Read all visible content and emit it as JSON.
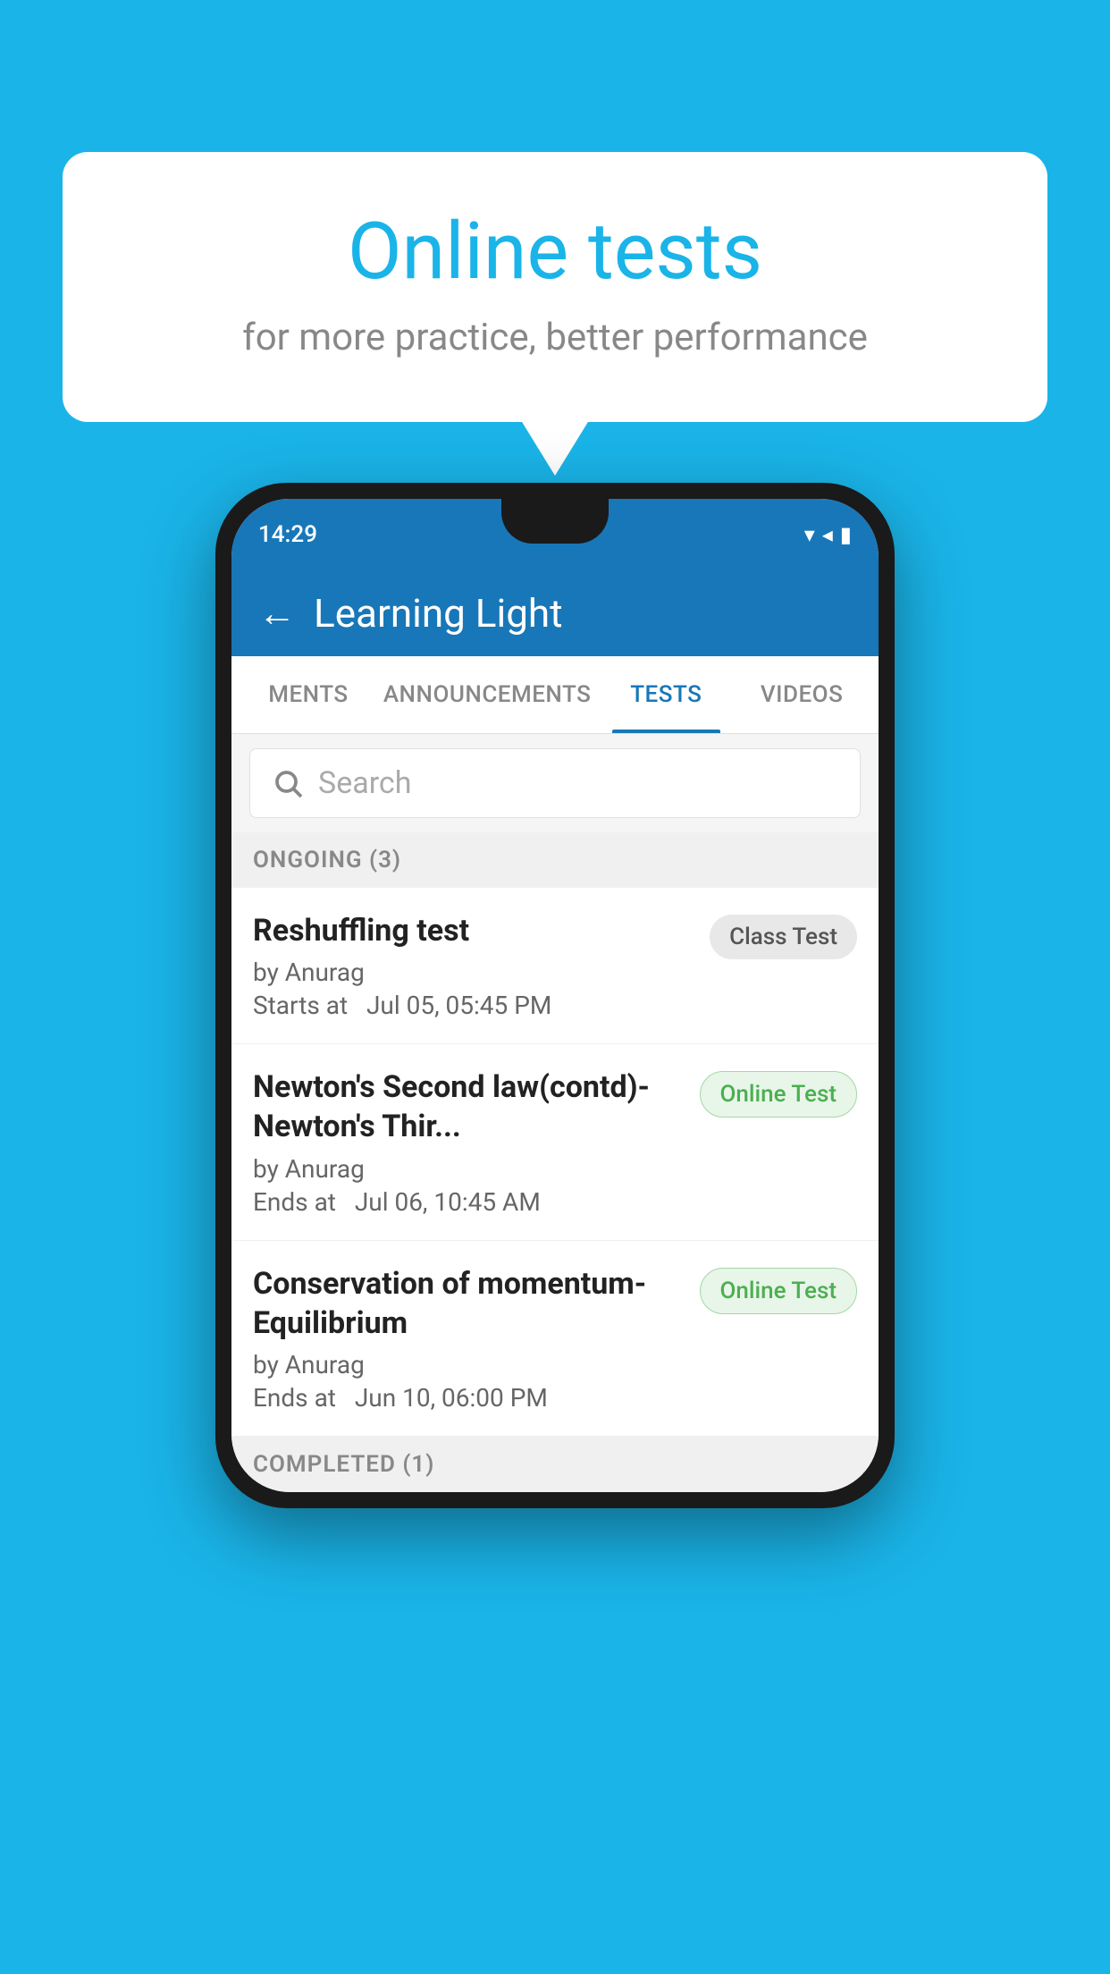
{
  "background": {
    "color": "#1ab4e8"
  },
  "speech_bubble": {
    "title": "Online tests",
    "subtitle": "for more practice, better performance"
  },
  "phone": {
    "status_bar": {
      "time": "14:29",
      "icons": [
        "wifi",
        "signal",
        "battery"
      ]
    },
    "header": {
      "title": "Learning Light",
      "back_label": "←"
    },
    "tabs": [
      {
        "label": "MENTS",
        "active": false
      },
      {
        "label": "ANNOUNCEMENTS",
        "active": false
      },
      {
        "label": "TESTS",
        "active": true
      },
      {
        "label": "VIDEOS",
        "active": false
      }
    ],
    "search": {
      "placeholder": "Search"
    },
    "sections": [
      {
        "label": "ONGOING (3)",
        "tests": [
          {
            "name": "Reshuffling test",
            "author": "by Anurag",
            "time_label": "Starts at",
            "time": "Jul 05, 05:45 PM",
            "badge": "Class Test",
            "badge_type": "class"
          },
          {
            "name": "Newton's Second law(contd)-Newton's Thir...",
            "author": "by Anurag",
            "time_label": "Ends at",
            "time": "Jul 06, 10:45 AM",
            "badge": "Online Test",
            "badge_type": "online"
          },
          {
            "name": "Conservation of momentum-Equilibrium",
            "author": "by Anurag",
            "time_label": "Ends at",
            "time": "Jun 10, 06:00 PM",
            "badge": "Online Test",
            "badge_type": "online"
          }
        ]
      },
      {
        "label": "COMPLETED (1)",
        "tests": []
      }
    ]
  }
}
